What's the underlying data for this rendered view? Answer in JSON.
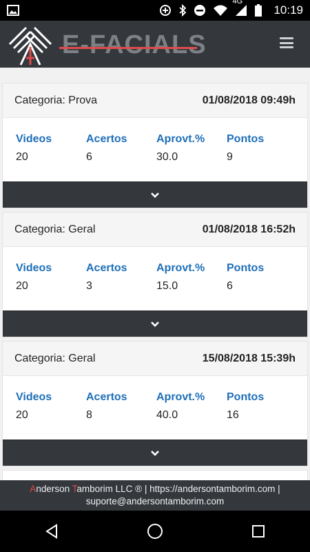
{
  "status_bar": {
    "time": "10:19",
    "network": "4G",
    "icons": [
      "image-icon",
      "data-saver-icon",
      "bluetooth-icon",
      "do-not-disturb-icon",
      "wifi-icon",
      "signal-icon",
      "battery-icon"
    ]
  },
  "header": {
    "logo_text": "E-FACIALS",
    "menu_icon": "hamburger-menu-icon"
  },
  "cards": [
    {
      "category": "Categoria: Prova",
      "datetime": "01/08/2018 09:49h",
      "stats": [
        {
          "label": "Videos",
          "value": "20"
        },
        {
          "label": "Acertos",
          "value": "6"
        },
        {
          "label": "Aprovt.%",
          "value": "30.0"
        },
        {
          "label": "Pontos",
          "value": "9"
        }
      ]
    },
    {
      "category": "Categoria: Geral",
      "datetime": "01/08/2018 16:52h",
      "stats": [
        {
          "label": "Videos",
          "value": "20"
        },
        {
          "label": "Acertos",
          "value": "3"
        },
        {
          "label": "Aprovt.%",
          "value": "15.0"
        },
        {
          "label": "Pontos",
          "value": "6"
        }
      ]
    },
    {
      "category": "Categoria: Geral",
      "datetime": "15/08/2018 15:39h",
      "stats": [
        {
          "label": "Videos",
          "value": "20"
        },
        {
          "label": "Acertos",
          "value": "8"
        },
        {
          "label": "Aprovt.%",
          "value": "40.0"
        },
        {
          "label": "Pontos",
          "value": "16"
        }
      ]
    }
  ],
  "footer": {
    "first_initial": "A",
    "first_rest": "nderson ",
    "last_initial": "T",
    "last_rest": "amborim LLC ® | https://andersontamborim.com |",
    "line2": "suporte@andersontamborim.com"
  },
  "colors": {
    "header_bg": "#34383d",
    "label_blue": "#1e6fb8",
    "accent_red": "#e04b4b"
  }
}
